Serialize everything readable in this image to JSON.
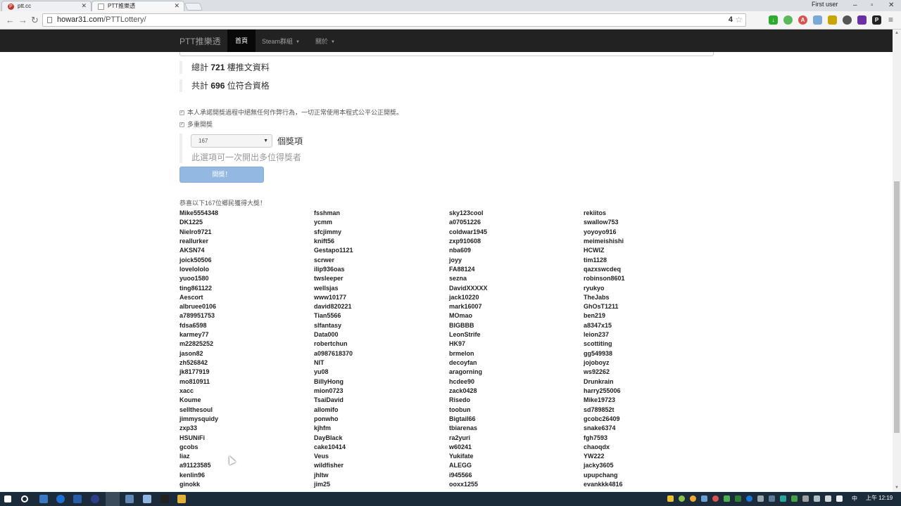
{
  "browser": {
    "tabs": [
      {
        "label": "ptt.cc",
        "active": false
      },
      {
        "label": "PTT推樂透",
        "active": true
      }
    ],
    "user": "First user",
    "url_host": "howar31.com",
    "url_path": "/PTTLottery/",
    "notification_count": "4"
  },
  "nav": {
    "brand": "PTT推樂透",
    "items": [
      "首頁",
      "Steam群組",
      "關於"
    ]
  },
  "stats": {
    "total_prefix": "總計",
    "total": "721",
    "total_suffix": "樓推文資料",
    "qualified_prefix": "共計",
    "qualified": "696",
    "qualified_suffix": "位符合資格"
  },
  "options": {
    "fairness_label": "本人承諾開獎過程中絕無任何作弊行為，一切正常使用本程式公平公正開獎。",
    "multi_label": "多重開獎",
    "count_value": "167",
    "count_suffix": "個獎項",
    "multi_help": "此選項可一次開出多位得獎者"
  },
  "draw_button": "開獎！",
  "congrats": "恭喜以下167位鄉民獲得大獎！",
  "winners": [
    [
      "Mike5554348",
      "DK1225",
      "Nielro9721",
      "reallurker",
      "AKSN74",
      "joick50506",
      "lovelololo",
      "yuoo1580",
      "ting861122",
      "Aescort",
      "albruee0106",
      "a789951753",
      "fdsa6598",
      "karmey77",
      "m22825252",
      "jason82",
      "zh526842",
      "jk8177919",
      "mo810911",
      "xacc",
      "Koume",
      "sellthesoul",
      "jimmysquidy",
      "zxp33",
      "HSUNiFi",
      "gcobs",
      "liaz",
      "a91123585",
      "kenlin96",
      "ginokk"
    ],
    [
      "fsshman",
      "ycmm",
      "sfcjimmy",
      "knift56",
      "Gestapo1121",
      "scrwer",
      "ilip936oas",
      "twsleeper",
      "wellsjas",
      "www10177",
      "david820221",
      "Tian5566",
      "slfantasy",
      "Data000",
      "robertchun",
      "a0987618370",
      "NIT",
      "yu08",
      "BillyHong",
      "mion0723",
      "TsaiDavid",
      "allomifo",
      "ponwho",
      "kjhfm",
      "DayBlack",
      "cake10414",
      "Veus",
      "wildfisher",
      "jhltw",
      "jim25"
    ],
    [
      "sky123cool",
      "a07051226",
      "coldwar1945",
      "zxp910608",
      "nba609",
      "joyy",
      "FA88124",
      "sezna",
      "DavidXXXXX",
      "jack10220",
      "mark16007",
      "MOmao",
      "BIGBBB",
      "LeonStrife",
      "HK97",
      "brmelon",
      "decoyfan",
      "aragorning",
      "hcdee90",
      "zack0428",
      "Risedo",
      "toobun",
      "Bigtail66",
      "tbiarenas",
      "ra2yuri",
      "w60241",
      "Yukifate",
      "ALEGG",
      "i945566",
      "ooxx1255"
    ],
    [
      "rekiitos",
      "swallow753",
      "yoyoyo916",
      "meimeishishi",
      "HCWIZ",
      "tim1128",
      "qazxswcdeq",
      "robinson8601",
      "ryukyo",
      "TheJabs",
      "GhOsT1211",
      "ben219",
      "a8347x15",
      "leion237",
      "scottiting",
      "gg549938",
      "jojoboyz",
      "ws92262",
      "Drunkrain",
      "harry255006",
      "Mike19723",
      "sd789852t",
      "gcobc26409",
      "snake6374",
      "fgh7593",
      "chaoqdx",
      "YW222",
      "jacky3605",
      "upupchang",
      "evankkk4816"
    ]
  ],
  "taskbar": {
    "time": "上午 12:19",
    "lang": "中"
  },
  "colors": {
    "navbar": "#222222",
    "button": "#93b9e3",
    "taskbar": "#1c2b3a"
  }
}
